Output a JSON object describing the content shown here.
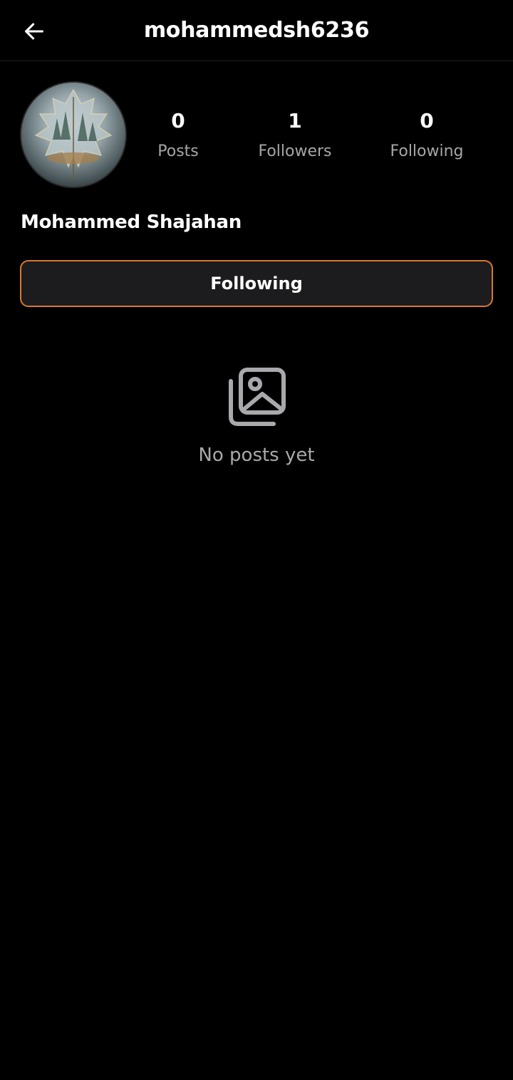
{
  "header": {
    "title": "mohammedsh6236",
    "back_icon": "arrow-left-icon"
  },
  "profile": {
    "display_name": "Mohammed Shajahan",
    "avatar_description": "forest-leaf-avatar",
    "stats": [
      {
        "value": "0",
        "label": "Posts"
      },
      {
        "value": "1",
        "label": "Followers"
      },
      {
        "value": "0",
        "label": "Following"
      }
    ],
    "follow_button_label": "Following",
    "follow_button_border_color": "#d9782f"
  },
  "posts": {
    "empty_icon": "images-icon",
    "empty_message": "No posts yet"
  }
}
